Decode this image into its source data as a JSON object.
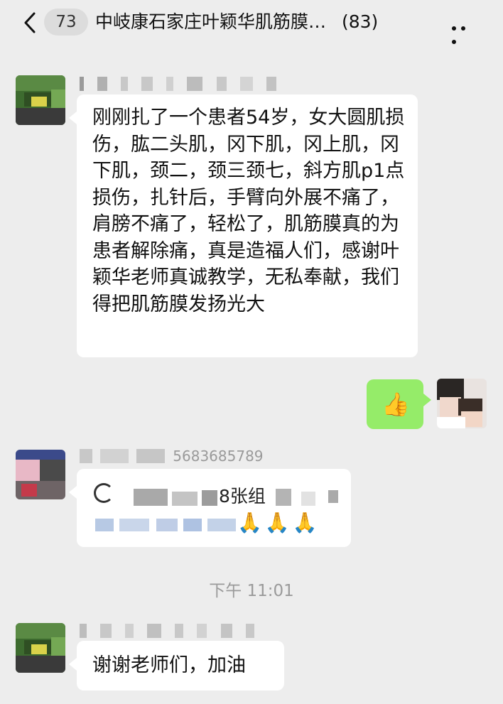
{
  "header": {
    "unread_count": "73",
    "title": "中岐康石家庄叶颖华肌筋膜…",
    "member_count": "(83)"
  },
  "messages": [
    {
      "side": "left",
      "text": "刚刚扎了一个患者54岁，女大圆肌损伤，肱二头肌，冈下肌，冈上肌，冈下肌，颈二，颈三颈七，斜方肌p1点损伤，扎针后，手臂向外展不痛了，肩膀不痛了，轻松了，肌筋膜真的为患者解除痛，真是造福人们，感谢叶颖华老师真诚教学，无私奉献，我们得把肌筋膜发扬光大"
    },
    {
      "side": "right",
      "emoji": "👍"
    },
    {
      "side": "left",
      "sender_visible": "5683685789",
      "line1_visible": "8张组",
      "emoji": "🙏🙏🙏"
    },
    {
      "side": "left",
      "text": "谢谢老师们，加油"
    }
  ],
  "time_divider": "下午 11:01",
  "colors": {
    "background": "#ededed",
    "bubble_incoming": "#ffffff",
    "bubble_outgoing": "#95ec69",
    "time_text": "#9a9a9a"
  }
}
